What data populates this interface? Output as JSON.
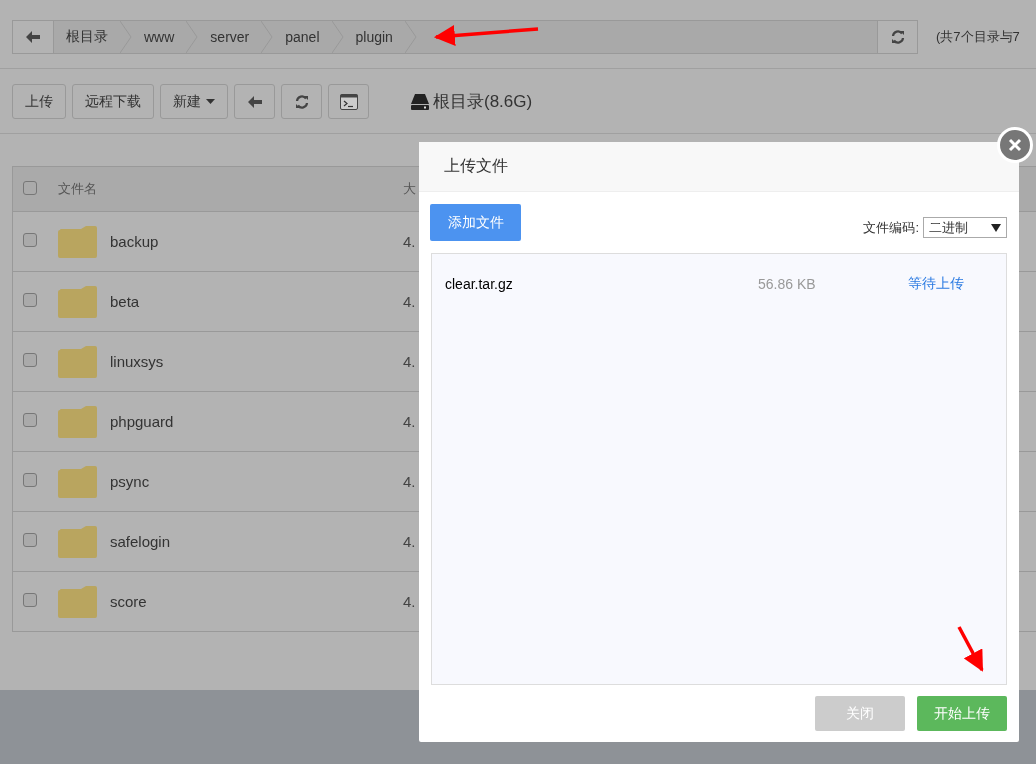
{
  "breadcrumb": {
    "items": [
      "根目录",
      "www",
      "server",
      "panel",
      "plugin"
    ]
  },
  "summary": "(共7个目录与7",
  "toolbar": {
    "buttons": [
      {
        "label": "上传",
        "kind": "plain"
      },
      {
        "label": "远程下载",
        "kind": "plain"
      },
      {
        "label": "新建",
        "kind": "dropdown"
      }
    ],
    "disk_label": "根目录(8.6G)"
  },
  "table": {
    "columns": [
      "文件名",
      "大"
    ],
    "select_all_checked": false,
    "rows": [
      {
        "name": "backup",
        "size": "4.",
        "checked": false
      },
      {
        "name": "beta",
        "size": "4.",
        "checked": false
      },
      {
        "name": "linuxsys",
        "size": "4.",
        "checked": false
      },
      {
        "name": "phpguard",
        "size": "4.",
        "checked": false
      },
      {
        "name": "psync",
        "size": "4.",
        "checked": false
      },
      {
        "name": "safelogin",
        "size": "4.",
        "checked": false
      },
      {
        "name": "score",
        "size": "4.",
        "checked": false
      }
    ]
  },
  "dialog": {
    "title": "上传文件",
    "add_button": "添加文件",
    "encoding_label": "文件编码:",
    "encoding_value": "二进制",
    "files": [
      {
        "name": "clear.tar.gz",
        "size": "56.86 KB",
        "status": "等待上传"
      }
    ],
    "buttons": [
      {
        "label": "关闭",
        "kind": "secondary"
      },
      {
        "label": "开始上传",
        "kind": "primary"
      }
    ]
  }
}
